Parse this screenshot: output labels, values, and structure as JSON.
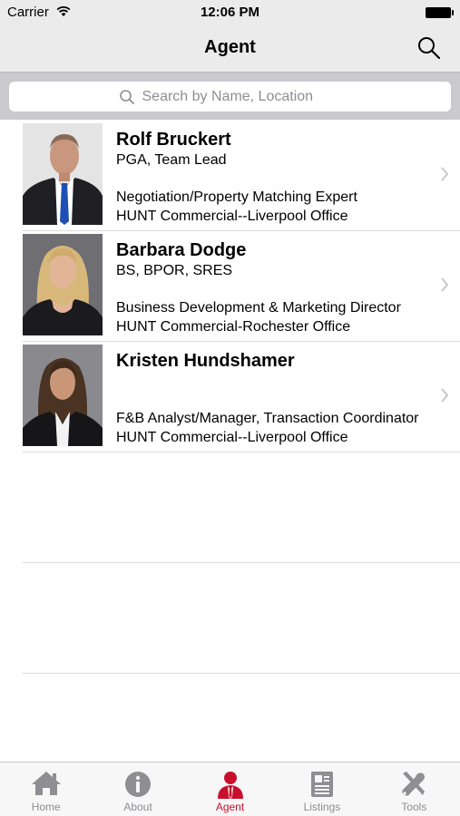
{
  "status_bar": {
    "carrier": "Carrier",
    "time": "12:06 PM"
  },
  "nav": {
    "title": "Agent"
  },
  "search": {
    "placeholder": "Search by Name, Location"
  },
  "agents": [
    {
      "name": "Rolf Bruckert",
      "credentials": "PGA, Team Lead",
      "role": "Negotiation/Property Matching Expert",
      "office": "HUNT Commercial--Liverpool Office"
    },
    {
      "name": "Barbara Dodge",
      "credentials": "BS, BPOR, SRES",
      "role": "Business Development & Marketing Director",
      "office": "HUNT Commercial-Rochester Office"
    },
    {
      "name": "Kristen Hundshamer",
      "credentials": "",
      "role": "F&B Analyst/Manager, Transaction Coordinator",
      "office": "HUNT Commercial--Liverpool Office"
    }
  ],
  "tabs": [
    {
      "label": "Home",
      "icon": "home-icon"
    },
    {
      "label": "About",
      "icon": "info-icon"
    },
    {
      "label": "Agent",
      "icon": "agent-icon"
    },
    {
      "label": "Listings",
      "icon": "listings-icon"
    },
    {
      "label": "Tools",
      "icon": "tools-icon"
    }
  ],
  "colors": {
    "accent": "#c8102e",
    "bar": "#ebebeb",
    "search_bg": "#c9c9ce",
    "inactive": "#8e8e93"
  }
}
